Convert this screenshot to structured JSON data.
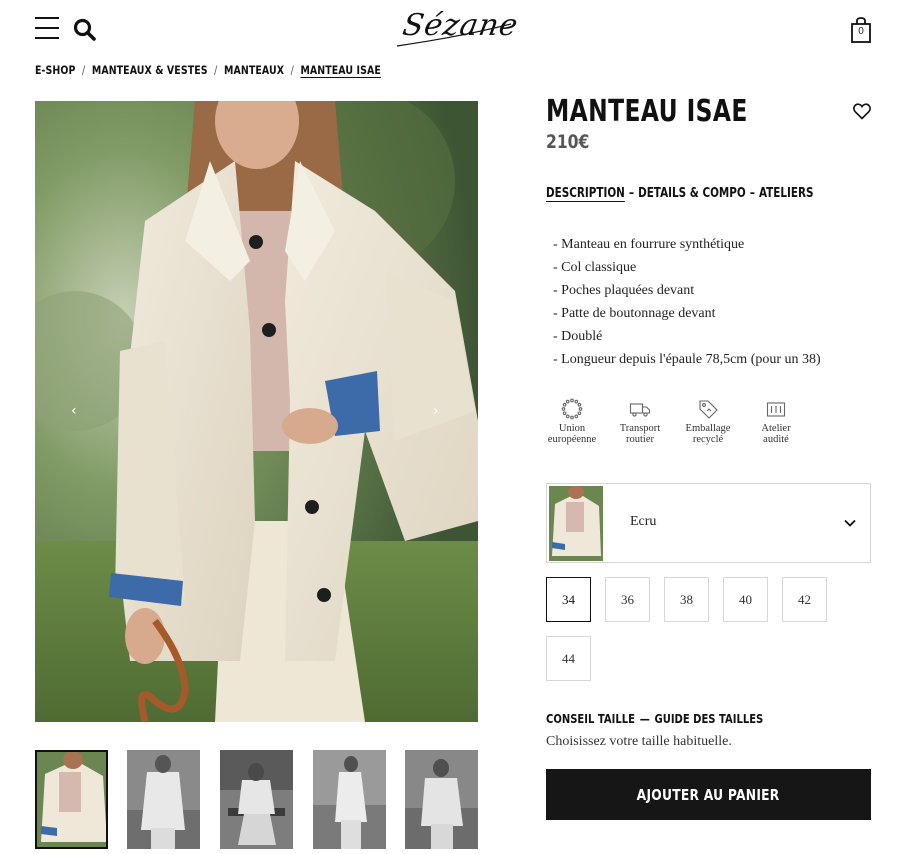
{
  "header": {
    "menu_icon": "hamburger-menu-icon",
    "search_icon": "search-icon",
    "logo_text": "Sézane",
    "cart_icon": "shopping-bag-icon",
    "cart_count": "0"
  },
  "breadcrumb": {
    "items": [
      "E-SHOP",
      "MANTEAUX & VESTES",
      "MANTEAUX"
    ],
    "current": "MANTEAU ISAE",
    "separator": "/"
  },
  "gallery": {
    "prev_icon": "chevron-left-icon",
    "next_icon": "chevron-right-icon",
    "prev_glyph": "‹",
    "next_glyph": "›",
    "thumbnail_count": 5,
    "active_thumbnail": 1
  },
  "product": {
    "title": "MANTEAU ISAE",
    "price": "210€",
    "wishlist_icon": "heart-icon"
  },
  "tabs": {
    "description": "DESCRIPTION",
    "details": "DETAILS & COMPO",
    "ateliers": "ATELIERS",
    "dash": "–"
  },
  "description": [
    "Manteau en fourrure synthétique",
    "Col classique",
    "Poches plaquées devant",
    "Patte de boutonnage devant",
    "Doublé",
    "Longueur depuis l'épaule 78,5cm (pour un 38)"
  ],
  "badges": [
    {
      "line1": "Union",
      "line2": "européenne",
      "icon": "eu-stars-icon"
    },
    {
      "line1": "Transport",
      "line2": "routier",
      "icon": "truck-icon"
    },
    {
      "line1": "Emballage",
      "line2": "recyclé",
      "icon": "recycle-tag-icon"
    },
    {
      "line1": "Atelier",
      "line2": "audité",
      "icon": "factory-icon"
    }
  ],
  "color": {
    "selected": "Ecru",
    "chevron_icon": "chevron-down-icon"
  },
  "sizes": [
    "34",
    "36",
    "38",
    "40",
    "42",
    "44"
  ],
  "selected_size": "34",
  "advice": {
    "conseil": "CONSEIL TAILLE",
    "guide": "GUIDE DES TAILLES",
    "dash": "—",
    "text": "Choisissez votre taille habituelle."
  },
  "cta": {
    "add_to_cart": "AJOUTER AU PANIER"
  },
  "colors": {
    "text": "#1a1a1a",
    "button_bg": "#161616",
    "border": "#d6d6d6",
    "price": "#555555"
  }
}
